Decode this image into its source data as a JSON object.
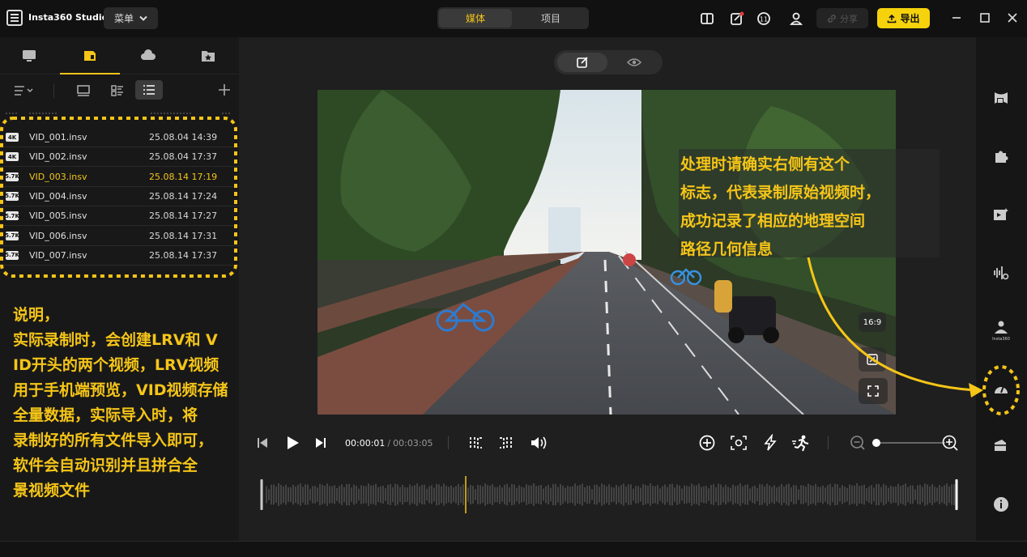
{
  "window": {
    "app_title": "Insta360 Studio",
    "menu_label": "菜单",
    "mode_tabs": [
      "媒体",
      "项目"
    ],
    "share_label": "分享",
    "export_label": "导出"
  },
  "left_panel": {
    "files": [
      {
        "res": "4K",
        "name": "VID_001.insv",
        "date": "25.08.04 14:39",
        "selected": false
      },
      {
        "res": "4K",
        "name": "VID_002.insv",
        "date": "25.08.04 17:37",
        "selected": false
      },
      {
        "res": "5.7K",
        "name": "VID_003.insv",
        "date": "25.08.14 17:19",
        "selected": true
      },
      {
        "res": "5.7K",
        "name": "VID_004.insv",
        "date": "25.08.14 17:24",
        "selected": false
      },
      {
        "res": "5.7K",
        "name": "VID_005.insv",
        "date": "25.08.14 17:27",
        "selected": false
      },
      {
        "res": "5.7K",
        "name": "VID_006.insv",
        "date": "25.08.14 17:31",
        "selected": false
      },
      {
        "res": "5.7K",
        "name": "VID_007.insv",
        "date": "25.08.14 17:37",
        "selected": false
      }
    ]
  },
  "player": {
    "current_time": "00:00:01",
    "separator": "/",
    "total_time": "00:03:05",
    "aspect_ratio": "16:9"
  },
  "annotations": {
    "left_note": [
      "说明，",
      "实际录制时，会创建LRV和 V",
      "ID开头的两个视频，LRV视频",
      "用于手机端预览，VID视频存储",
      "全量数据，实际导入时，将",
      "录制好的所有文件导入即可，",
      "软件会自动识别并且拼合全",
      "景视频文件"
    ],
    "right_note": [
      "处理时请确实右侧有这个",
      "标志，代表录制原始视频时，",
      "成功记录了相应的地理空间",
      "路径几何信息"
    ]
  },
  "colors": {
    "accent": "#f5c518",
    "export_button": "#f5d20c",
    "annotation": "#f5c518"
  }
}
